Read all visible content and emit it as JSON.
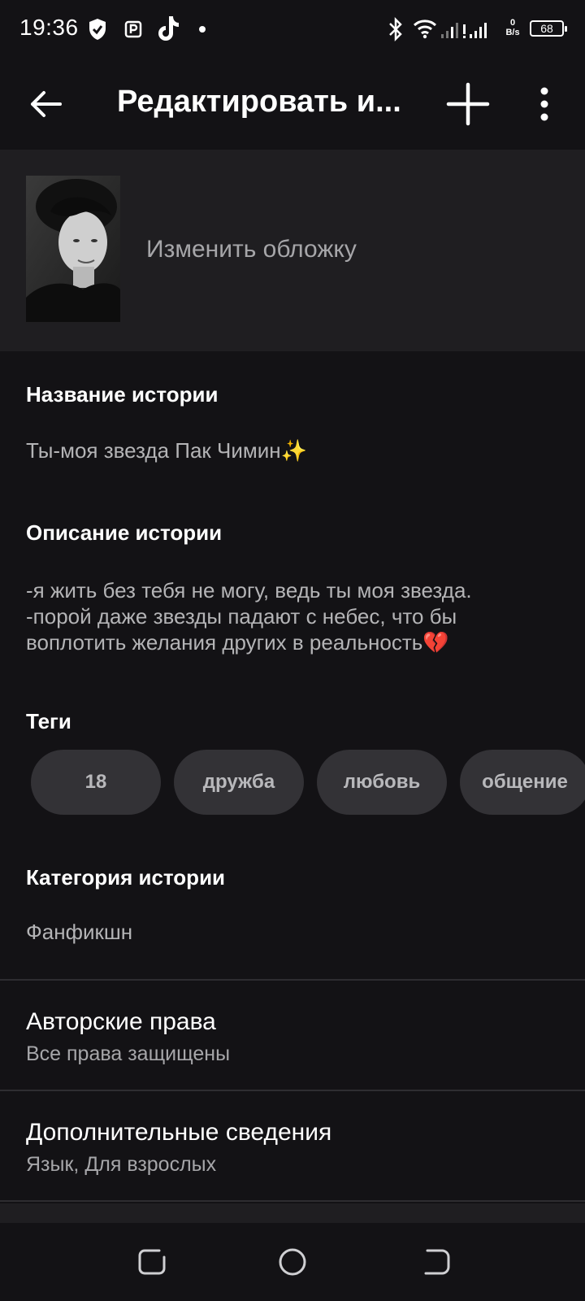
{
  "status_bar": {
    "time": "19:36",
    "net_speed_value": "0",
    "net_speed_unit": "B/s",
    "battery": "68",
    "icons": [
      "shield-icon",
      "parking-icon",
      "tiktok-icon",
      "dot-icon",
      "bluetooth-icon",
      "wifi-icon",
      "signal-icon",
      "signal-alert-icon"
    ]
  },
  "app_bar": {
    "title": "Редактировать и...",
    "icons": [
      "back-arrow-icon",
      "plus-icon",
      "more-vertical-icon"
    ]
  },
  "cover": {
    "label": "Изменить обложку"
  },
  "story_title": {
    "label": "Название истории",
    "value": "Ты-моя звезда Пак Чимин",
    "emoji": "✨"
  },
  "story_description": {
    "label": "Описание истории",
    "lines": [
      "-я жить без тебя не могу, ведь ты моя звезда.",
      "-порой даже звезды падают с небес, что бы",
      "воплотить желания других в реальность"
    ],
    "emoji": "💔"
  },
  "tags": {
    "label": "Теги",
    "items": [
      "18",
      "дружба",
      "любовь",
      "общение"
    ]
  },
  "category": {
    "label": "Категория истории",
    "value": "Фанфикшн"
  },
  "copyright": {
    "title": "Авторские права",
    "subtitle": "Все права защищены"
  },
  "additional": {
    "title": "Дополнительные сведения",
    "subtitle": "Язык, Для взрослых"
  },
  "nav_bar": {
    "icons": [
      "recents-icon",
      "home-icon",
      "back-icon"
    ]
  },
  "colors": {
    "background": "#131215",
    "surface": "#1f1e21",
    "chip": "#333236",
    "secondary_text": "#b4b4b6"
  }
}
